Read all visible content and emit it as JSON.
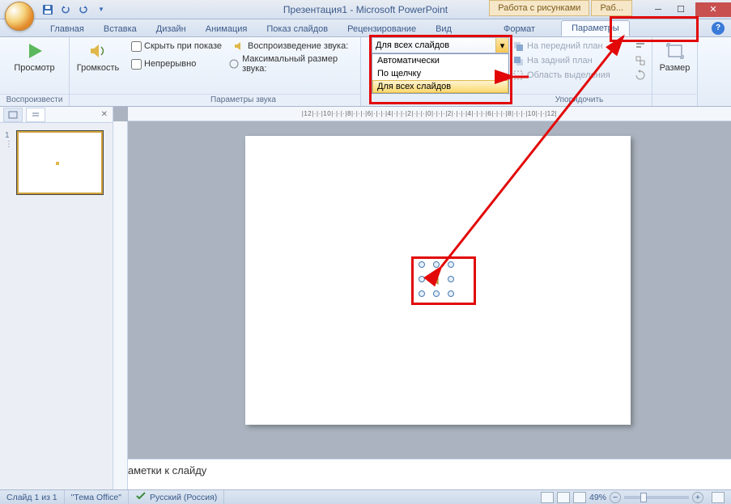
{
  "titlebar": {
    "title": "Презентация1 - Microsoft PowerPoint",
    "context_tabs": [
      "Работа с рисунками",
      "Раб..."
    ]
  },
  "tabs": {
    "items": [
      "Главная",
      "Вставка",
      "Дизайн",
      "Анимация",
      "Показ слайдов",
      "Рецензирование",
      "Вид",
      "Формат",
      "Параметры"
    ],
    "active": "Параметры"
  },
  "ribbon": {
    "play": {
      "preview": "Просмотр",
      "group": "Воспроизвести"
    },
    "volume": {
      "label": "Громкость"
    },
    "sound_params": {
      "hide": "Скрыть при показе",
      "loop": "Непрерывно",
      "playback": "Воспроизведение звука:",
      "maxsize": "Максимальный размер звука:",
      "group": "Параметры звука"
    },
    "dropdown": {
      "selected": "Для всех слайдов",
      "items": [
        "Автоматически",
        "По щелчку",
        "Для всех слайдов"
      ]
    },
    "arrange": {
      "front": "На передний план",
      "back": "На задний план",
      "selection": "Область выделения",
      "group": "Упорядочить"
    },
    "size": {
      "label": "Размер"
    }
  },
  "ruler": "|12|·|·|10|·|·|·|8|·|·|·|6|·|·|·|4|·|·|·|2|·|·|·|0|·|·|·|2|·|·|·|4|·|·|·|6|·|·|·|8|·|·|·|10|·|·|12|",
  "notes": "Заметки к слайду",
  "status": {
    "slide": "Слайд 1 из 1",
    "theme": "\"Тема Office\"",
    "lang": "Русский (Россия)",
    "zoom": "49%"
  }
}
